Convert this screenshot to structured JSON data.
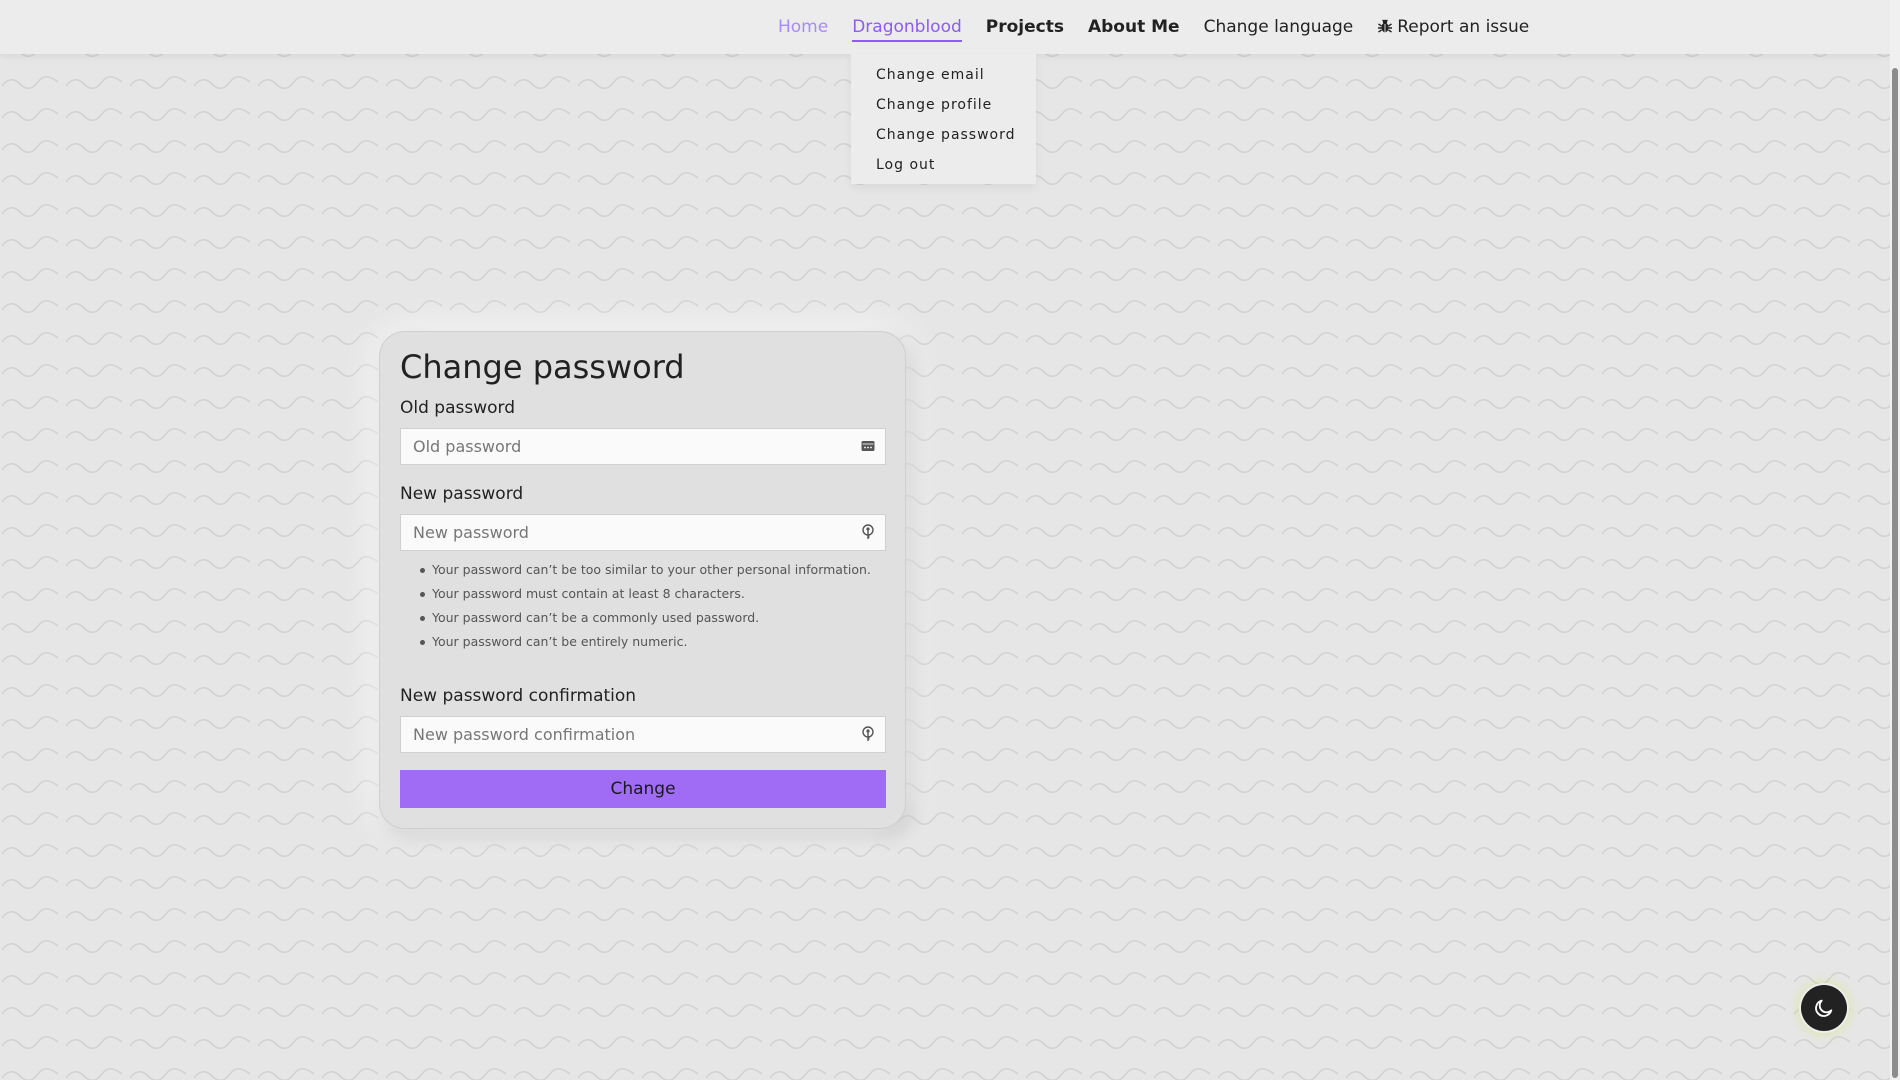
{
  "nav": {
    "home": "Home",
    "user": "Dragonblood",
    "projects": "Projects",
    "about": "About Me",
    "language": "Change language",
    "report": "Report an issue"
  },
  "dropdown": {
    "items": [
      "Change email",
      "Change profile",
      "Change password",
      "Log out"
    ]
  },
  "form": {
    "title": "Change password",
    "old_label": "Old password",
    "old_placeholder": "Old password",
    "new_label": "New password",
    "new_placeholder": "New password",
    "hints": [
      "Your password can’t be too similar to your other personal information.",
      "Your password must contain at least 8 characters.",
      "Your password can’t be a commonly used password.",
      "Your password can’t be entirely numeric."
    ],
    "confirm_label": "New password confirmation",
    "confirm_placeholder": "New password confirmation",
    "submit": "Change"
  },
  "colors": {
    "accent": "#a06cf6",
    "active_link": "#8b5cf6",
    "home_link": "#a78bfa"
  },
  "icons": {
    "report": "bug-icon",
    "old_field": "password-manager-icon",
    "new_field": "key-icon",
    "theme": "moon-icon"
  }
}
